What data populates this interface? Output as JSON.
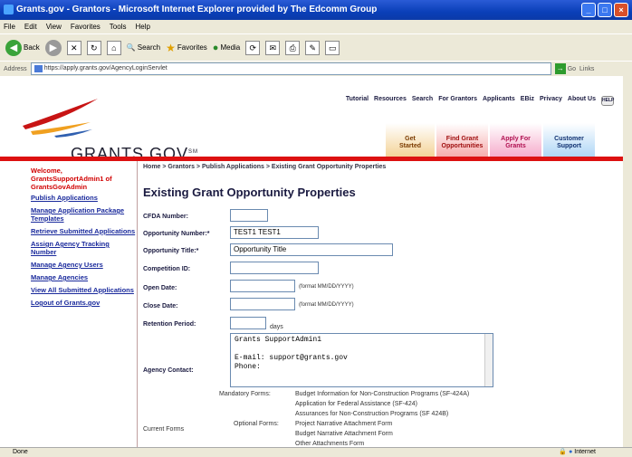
{
  "window": {
    "title": "Grants.gov - Grantors - Microsoft Internet Explorer provided by The Edcomm Group"
  },
  "menu": [
    "File",
    "Edit",
    "View",
    "Favorites",
    "Tools",
    "Help"
  ],
  "toolbar": {
    "back": "Back",
    "search": "Search",
    "favorites": "Favorites",
    "media": "Media"
  },
  "address": {
    "label": "Address",
    "url": "https://apply.grants.gov/AgencyLoginServlet",
    "go": "Go",
    "links": "Links"
  },
  "topnav": [
    "Tutorial",
    "Resources",
    "Search",
    "For Grantors",
    "Applicants",
    "EBiz",
    "Privacy",
    "About Us"
  ],
  "help_badge": "HELP",
  "logo": {
    "text": "GRANTS.GOV",
    "sm": "SM"
  },
  "tabs": [
    {
      "line1": "Get",
      "line2": "Started"
    },
    {
      "line1": "Find Grant",
      "line2": "Opportunities"
    },
    {
      "line1": "Apply For",
      "line2": "Grants"
    },
    {
      "line1": "Customer",
      "line2": "Support"
    }
  ],
  "sidebar": {
    "welcome": "Welcome, GrantsSupportAdmin1 of GrantsGovAdmin",
    "links": [
      "Publish Applications",
      "Manage Application Package Templates",
      "Retrieve Submitted Applications",
      "Assign Agency Tracking Number",
      "Manage Agency Users",
      "Manage Agencies",
      "View All Submitted Applications",
      "Logout of Grants.gov"
    ]
  },
  "breadcrumb": "Home > Grantors > Publish Applications > Existing Grant Opportunity Properties",
  "page_title": "Existing Grant Opportunity Properties",
  "form": {
    "cfda_label": "CFDA Number:",
    "cfda_value": "",
    "opp_num_label": "Opportunity Number:*",
    "opp_num_value": "TEST1 TEST1",
    "opp_title_label": "Opportunity Title:*",
    "opp_title_value": "Opportunity Title",
    "comp_id_label": "Competition ID:",
    "comp_id_value": "",
    "open_date_label": "Open Date:",
    "open_date_value": "",
    "open_date_fmt": "(format MM/DD/YYYY)",
    "close_date_label": "Close Date:",
    "close_date_value": "",
    "close_date_fmt": "(format MM/DD/YYYY)",
    "retention_label": "Retention Period:",
    "retention_value": "",
    "retention_unit": "days",
    "agency_contact_label": "Agency Contact:",
    "agency_contact_lines": [
      "Grants SupportAdmin1",
      "",
      "E-mail: support@grants.gov",
      "Phone:"
    ],
    "current_forms_label": "Current Forms",
    "mandatory_label": "Mandatory Forms:",
    "mandatory_forms": [
      "Budget Information for Non-Construction Programs (SF-424A)",
      "Application for Federal Assistance (SF-424)",
      "Assurances for Non-Construction Programs (SF 424B)"
    ],
    "optional_label": "Optional Forms:",
    "optional_forms": [
      "Project Narrative Attachment Form",
      "Budget Narrative Attachment Form",
      "Other Attachments Form"
    ]
  },
  "status": {
    "left": "Done",
    "right": "Internet"
  }
}
